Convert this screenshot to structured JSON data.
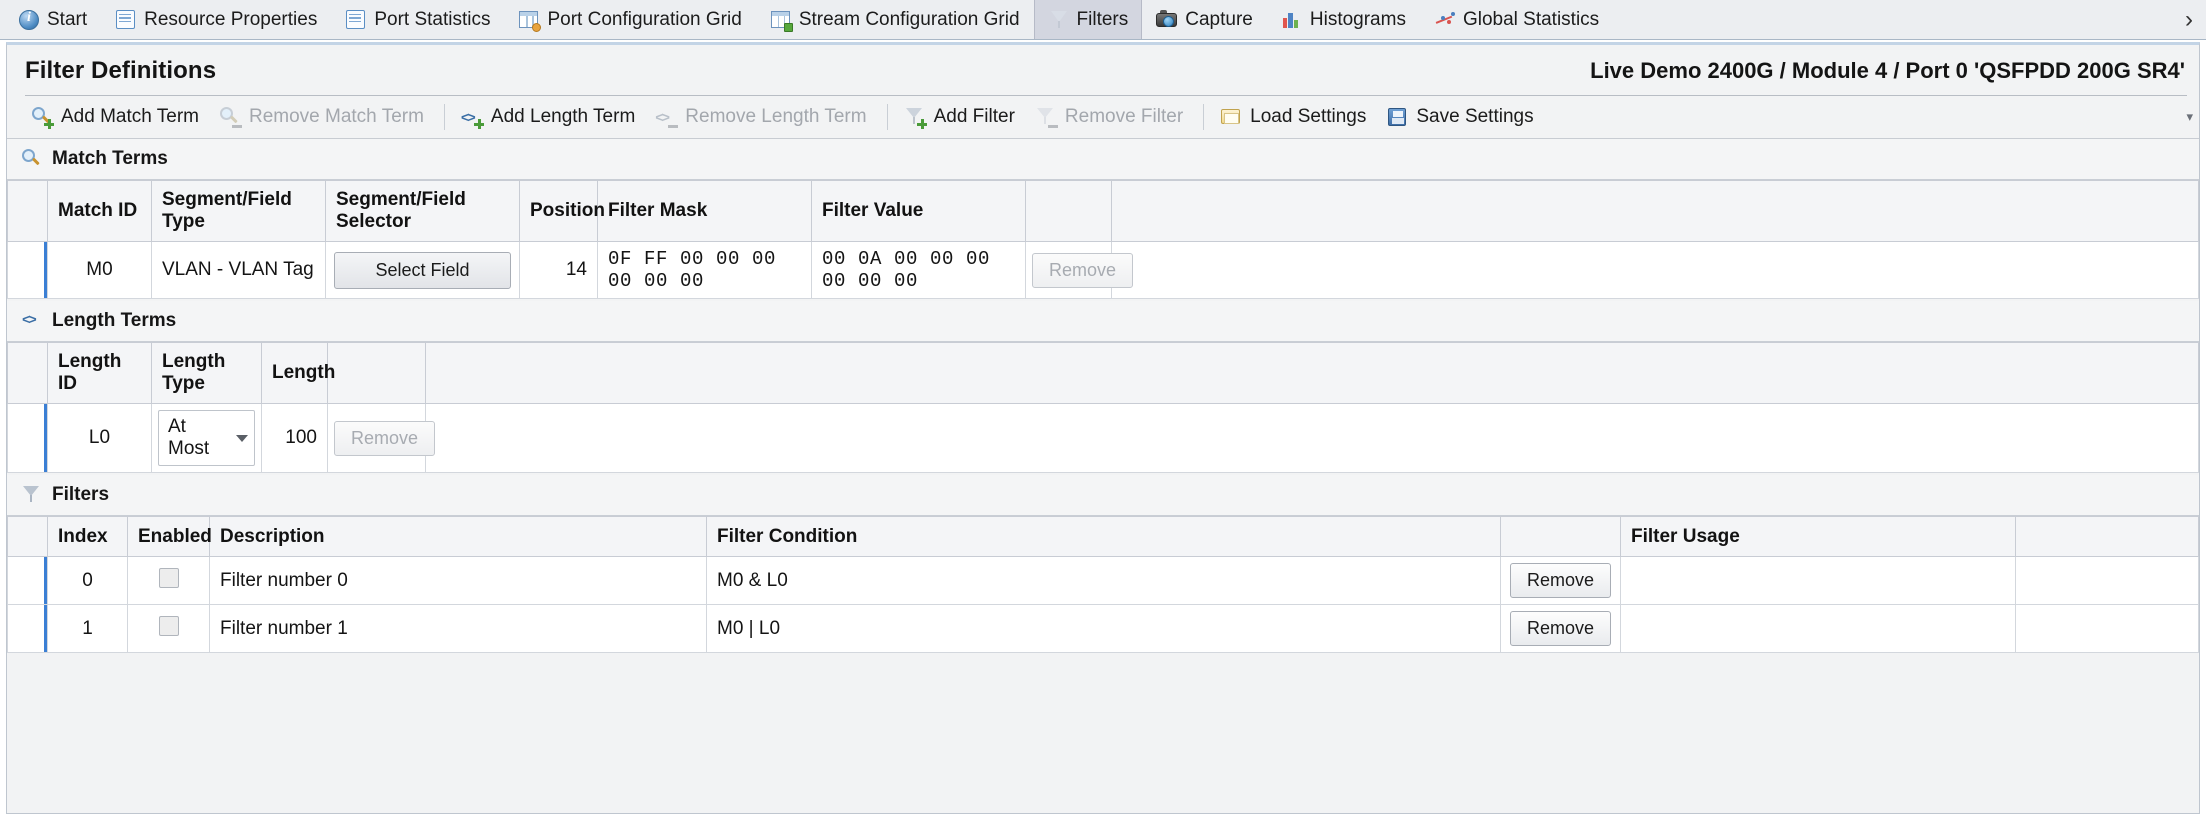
{
  "tabs": [
    {
      "label": "Start",
      "icon": "info-icon",
      "active": false
    },
    {
      "label": "Resource Properties",
      "icon": "resource-properties-icon",
      "active": false
    },
    {
      "label": "Port Statistics",
      "icon": "port-statistics-icon",
      "active": false
    },
    {
      "label": "Port Configuration Grid",
      "icon": "port-configuration-grid-icon",
      "active": false
    },
    {
      "label": "Stream Configuration Grid",
      "icon": "stream-configuration-grid-icon",
      "active": false
    },
    {
      "label": "Filters",
      "icon": "filter-icon",
      "active": true
    },
    {
      "label": "Capture",
      "icon": "camera-icon",
      "active": false
    },
    {
      "label": "Histograms",
      "icon": "bar-chart-icon",
      "active": false
    },
    {
      "label": "Global Statistics",
      "icon": "scatter-chart-icon",
      "active": false
    }
  ],
  "tabbar": {
    "scroll_right": "›"
  },
  "panel": {
    "title": "Filter Definitions",
    "subtitle": "Live Demo 2400G / Module 4 / Port 0 'QSFPDD 200G SR4'"
  },
  "toolbar": {
    "overflow": "▾",
    "buttons": [
      {
        "label": "Add Match Term",
        "icon": "add-match-term-icon",
        "disabled": false
      },
      {
        "label": "Remove Match Term",
        "icon": "remove-match-term-icon",
        "disabled": true
      },
      {
        "label": "Add Length Term",
        "icon": "add-length-term-icon",
        "disabled": false
      },
      {
        "label": "Remove Length Term",
        "icon": "remove-length-term-icon",
        "disabled": true
      },
      {
        "label": "Add Filter",
        "icon": "add-filter-icon",
        "disabled": false
      },
      {
        "label": "Remove Filter",
        "icon": "remove-filter-icon",
        "disabled": true
      },
      {
        "label": "Load Settings",
        "icon": "load-settings-icon",
        "disabled": false
      },
      {
        "label": "Save Settings",
        "icon": "save-settings-icon",
        "disabled": false
      }
    ]
  },
  "match_terms": {
    "section_title": "Match Terms",
    "section_icon": "magnifier-icon",
    "columns": [
      "",
      "Match ID",
      "Segment/Field Type",
      "Segment/Field Selector",
      "Position",
      "Filter Mask",
      "Filter Value",
      "",
      ""
    ],
    "rows": [
      {
        "match_id": "M0",
        "segment_field_type": "VLAN - VLAN Tag",
        "selector_button": "Select Field",
        "position": "14",
        "filter_mask": "0F FF 00 00 00 00 00 00",
        "filter_value": "00 0A 00 00 00 00 00 00",
        "remove_label": "Remove",
        "remove_disabled": true
      }
    ]
  },
  "length_terms": {
    "section_title": "Length Terms",
    "section_icon": "length-term-icon",
    "columns": [
      "",
      "Length ID",
      "Length Type",
      "Length",
      "",
      ""
    ],
    "rows": [
      {
        "length_id": "L0",
        "length_type": "At Most",
        "length": "100",
        "remove_label": "Remove",
        "remove_disabled": true
      }
    ]
  },
  "filters": {
    "section_title": "Filters",
    "section_icon": "filter-icon",
    "columns": [
      "",
      "Index",
      "Enabled",
      "Description",
      "Filter Condition",
      "",
      "Filter Usage",
      ""
    ],
    "rows": [
      {
        "index": "0",
        "enabled": false,
        "description": "Filter number 0",
        "condition": "M0 & L0",
        "remove_label": "Remove",
        "usage": ""
      },
      {
        "index": "1",
        "enabled": false,
        "description": "Filter number 1",
        "condition": "M0  |  L0",
        "remove_label": "Remove",
        "usage": ""
      }
    ]
  },
  "colors": {
    "accent": "#3b7fd4",
    "tab_active_bg": "#d3d6e0",
    "panel_bg": "#f2f3f4",
    "grid_border": "#d3d7dd"
  }
}
